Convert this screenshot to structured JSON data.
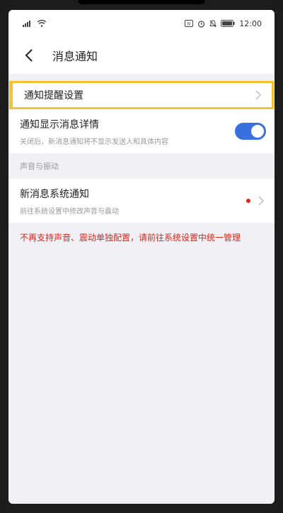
{
  "status_bar": {
    "time": "12:00",
    "icons": [
      "signal-icon",
      "wifi-icon",
      "nfc-icon",
      "alarm-icon",
      "mute-icon",
      "battery-icon"
    ]
  },
  "nav": {
    "title": "消息通知"
  },
  "rows": {
    "reminder_settings": {
      "label": "通知提醒设置"
    },
    "show_details": {
      "label": "通知显示消息详情",
      "sub": "关闭后，新消息通知将不显示发送人和具体内容",
      "toggle_on": true
    }
  },
  "section": {
    "title": "声音与振动"
  },
  "system_notify": {
    "label": "新消息系统通知",
    "sub": "前往系统设置中修改声音与震动"
  },
  "warning_text": "不再支持声音、震动单独配置，请前往系统设置中统一管理",
  "colors": {
    "highlight_border": "#f2c230",
    "toggle_active": "#3a6fe0",
    "warning": "#e0251b"
  }
}
